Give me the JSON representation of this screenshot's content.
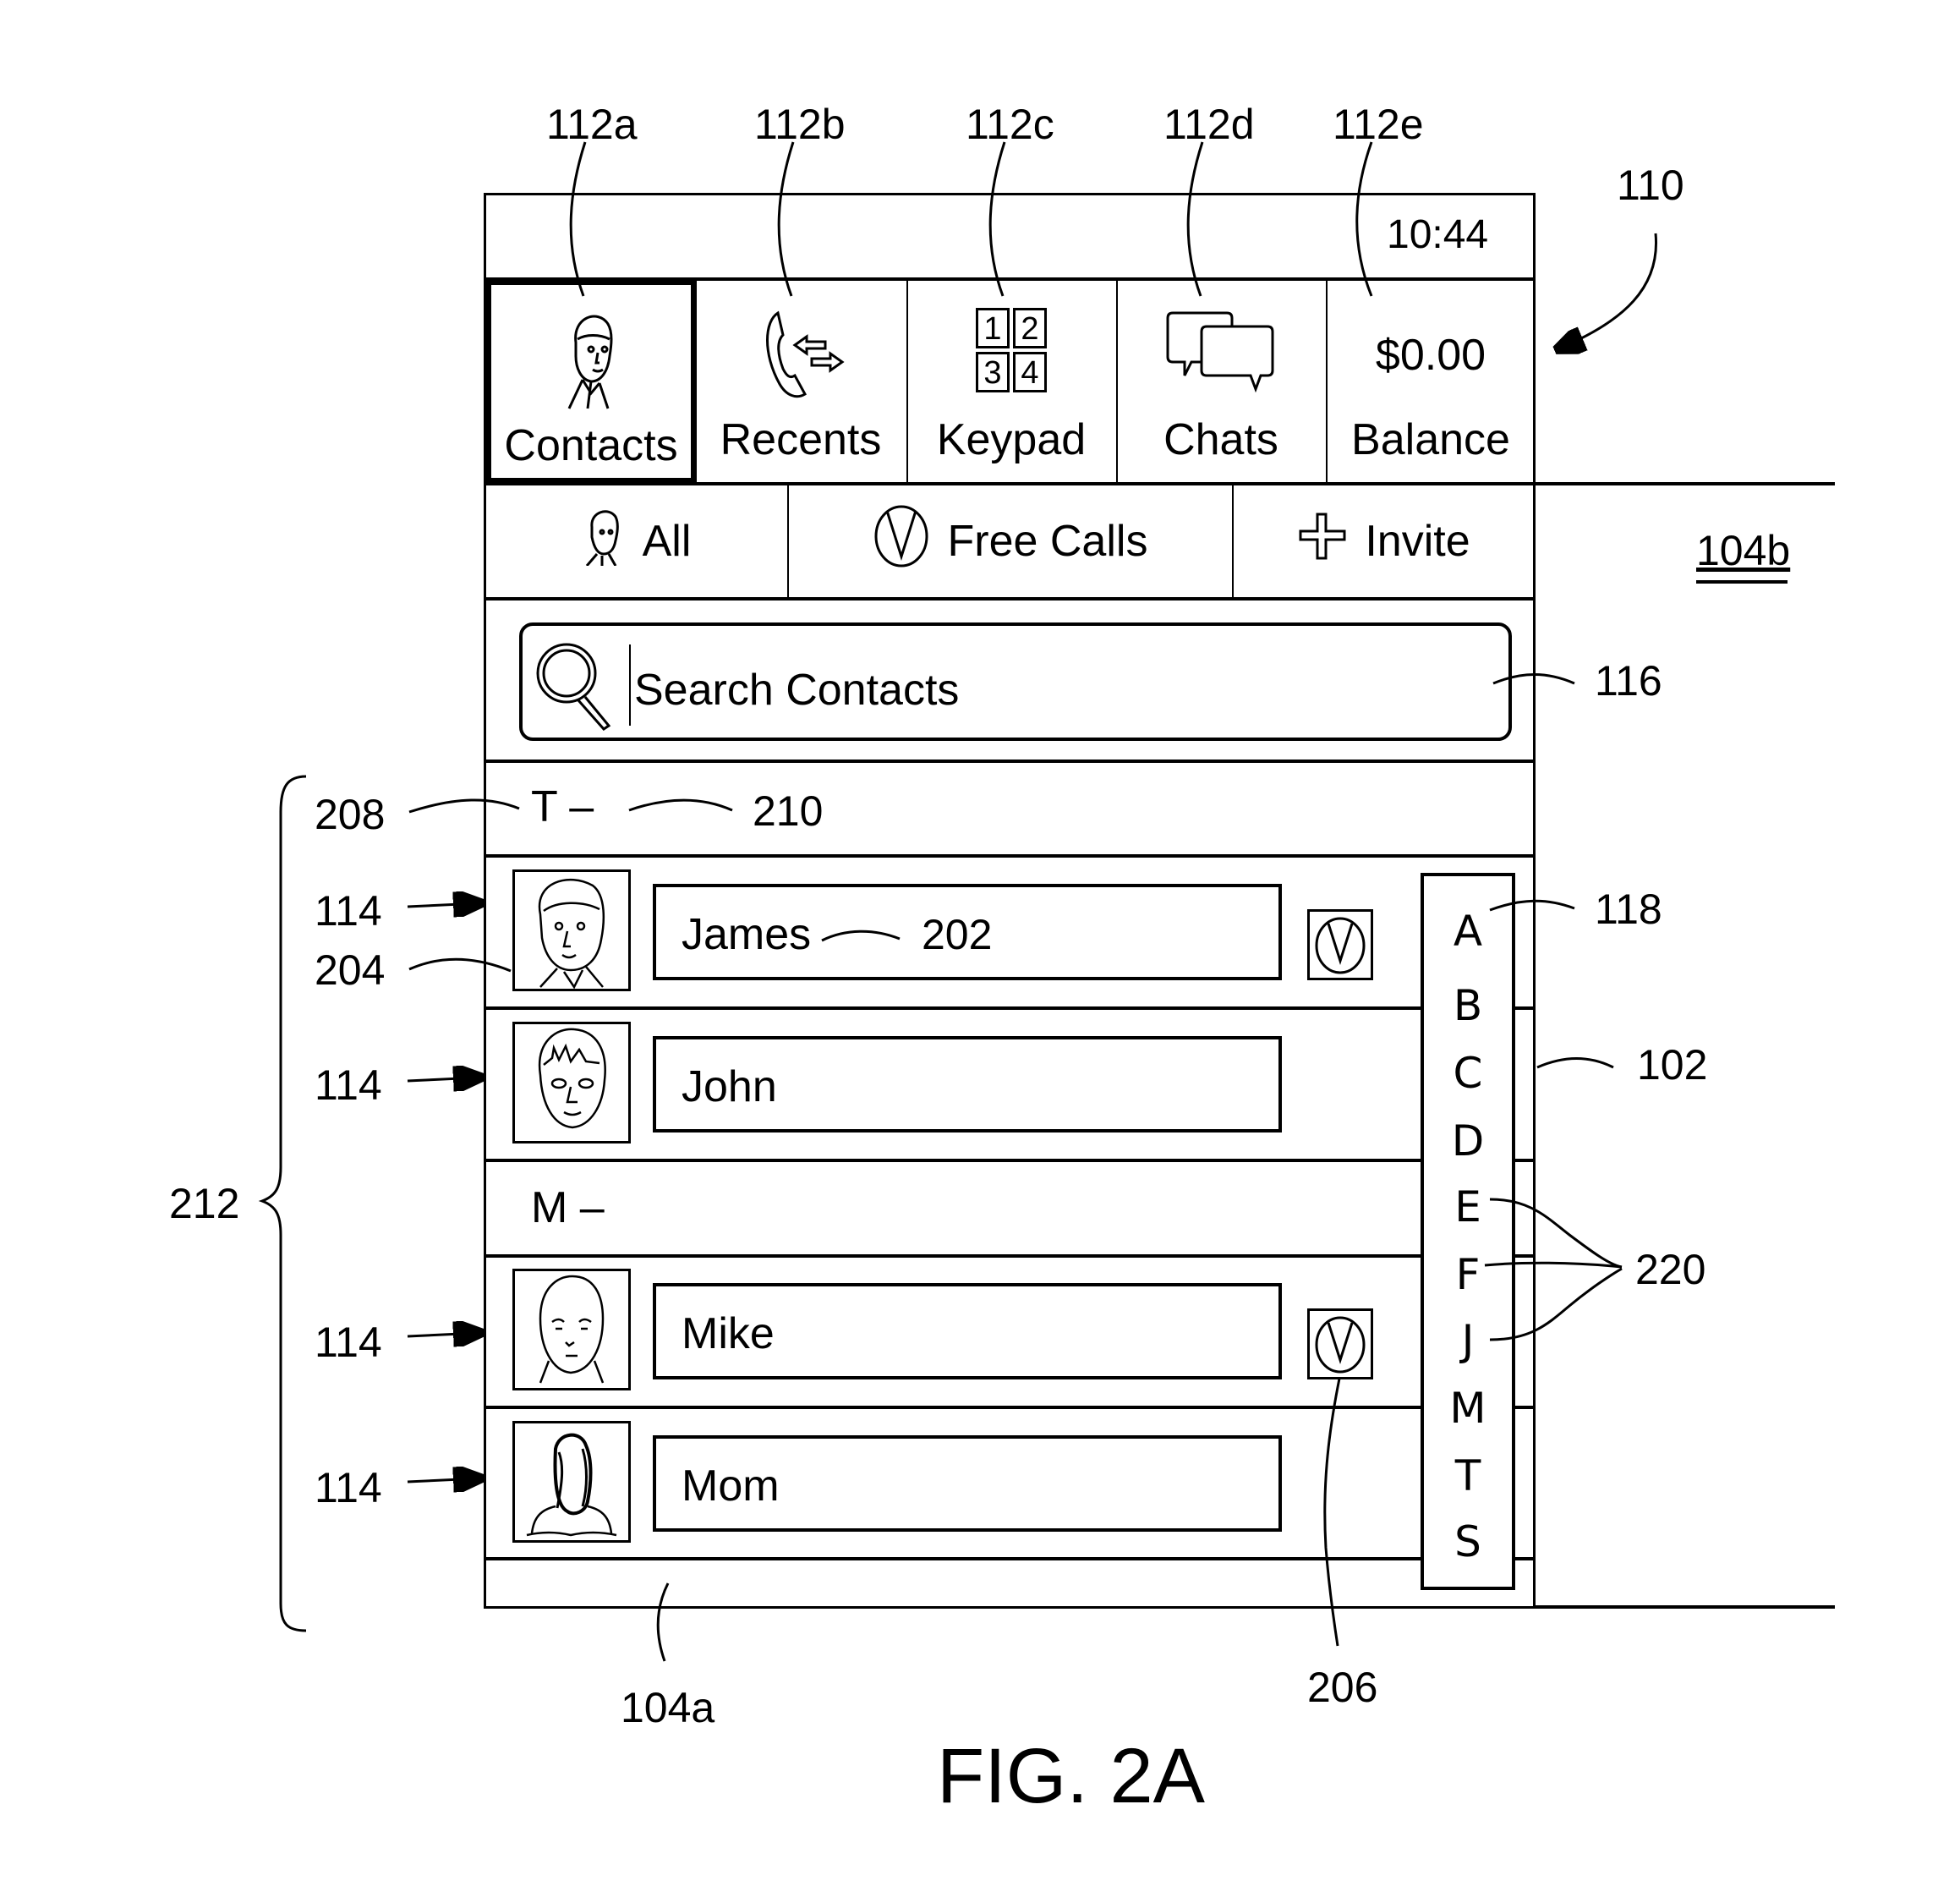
{
  "status_bar": {
    "time": "10:44"
  },
  "tabs": [
    {
      "label": "Contacts",
      "icon": "contact-person-icon",
      "active": true
    },
    {
      "label": "Recents",
      "icon": "phone-transfer-icon",
      "active": false
    },
    {
      "label": "Keypad",
      "icon": "keypad-icon",
      "keys": [
        "1",
        "2",
        "3",
        "4"
      ],
      "active": false
    },
    {
      "label": "Chats",
      "icon": "chat-bubbles-icon",
      "active": false
    },
    {
      "label": "Balance",
      "value": "$0.00",
      "active": false
    }
  ],
  "filters": [
    {
      "label": "All",
      "icon": "person-icon"
    },
    {
      "label": "Free Calls",
      "icon": "v-circle-icon"
    },
    {
      "label": "Invite",
      "icon": "plus-icon"
    }
  ],
  "search": {
    "placeholder": "Search Contacts"
  },
  "sections": [
    {
      "letter": "T –",
      "contacts": [
        {
          "name": "James",
          "free_call": true
        },
        {
          "name": "John",
          "free_call": false
        }
      ]
    },
    {
      "letter": "M –",
      "contacts": [
        {
          "name": "Mike",
          "free_call": true
        },
        {
          "name": "Mom",
          "free_call": false
        }
      ]
    }
  ],
  "alphabet_index": [
    "A",
    "B",
    "C",
    "D",
    "E",
    "F",
    "J",
    "M",
    "T",
    "S"
  ],
  "reference_numerals": {
    "r112a": "112a",
    "r112b": "112b",
    "r112c": "112c",
    "r112d": "112d",
    "r112e": "112e",
    "r110": "110",
    "r104b": "104b",
    "r116": "116",
    "r208": "208",
    "r210": "210",
    "r114": "114",
    "r204": "204",
    "r202": "202",
    "r118": "118",
    "r102": "102",
    "r212": "212",
    "r220": "220",
    "r104a": "104a",
    "r206": "206"
  },
  "figure_caption": "FIG. 2A"
}
